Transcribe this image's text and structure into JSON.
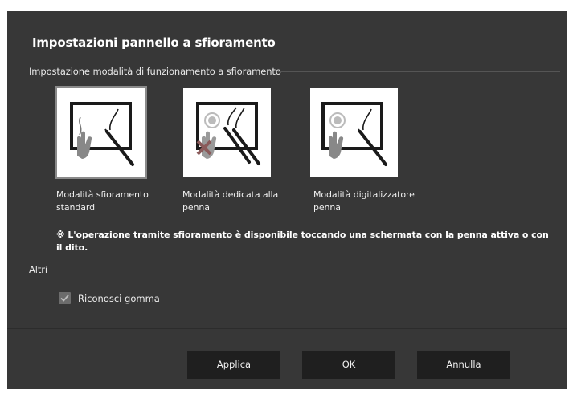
{
  "dialog": {
    "title": "Impostazioni pannello a sfioramento"
  },
  "touch_mode_section": {
    "label": "Impostazione modalità di funzionamento a sfioramento",
    "modes": [
      {
        "label": "Modalità sfioramento standard",
        "icon": "hand-and-pen-icon",
        "selected": true
      },
      {
        "label": "Modalità dedicata alla penna",
        "icon": "pen-only-icon",
        "selected": false
      },
      {
        "label": "Modalità digitalizzatore penna",
        "icon": "digitizer-pen-icon",
        "selected": false
      }
    ],
    "note": "※ L'operazione tramite sfioramento è disponibile toccando una schermata con la penna attiva o con il dito."
  },
  "others_section": {
    "label": "Altri",
    "eraser_checkbox": {
      "label": "Riconosci gomma",
      "checked": true
    }
  },
  "buttons": {
    "apply": "Applica",
    "ok": "OK",
    "cancel": "Annulla"
  },
  "colors": {
    "dialog_bg": "#373737",
    "button_bg": "#1f1f1f",
    "checkbox_bg": "#6c6c6c",
    "selected_outline": "#8a8a8a"
  }
}
